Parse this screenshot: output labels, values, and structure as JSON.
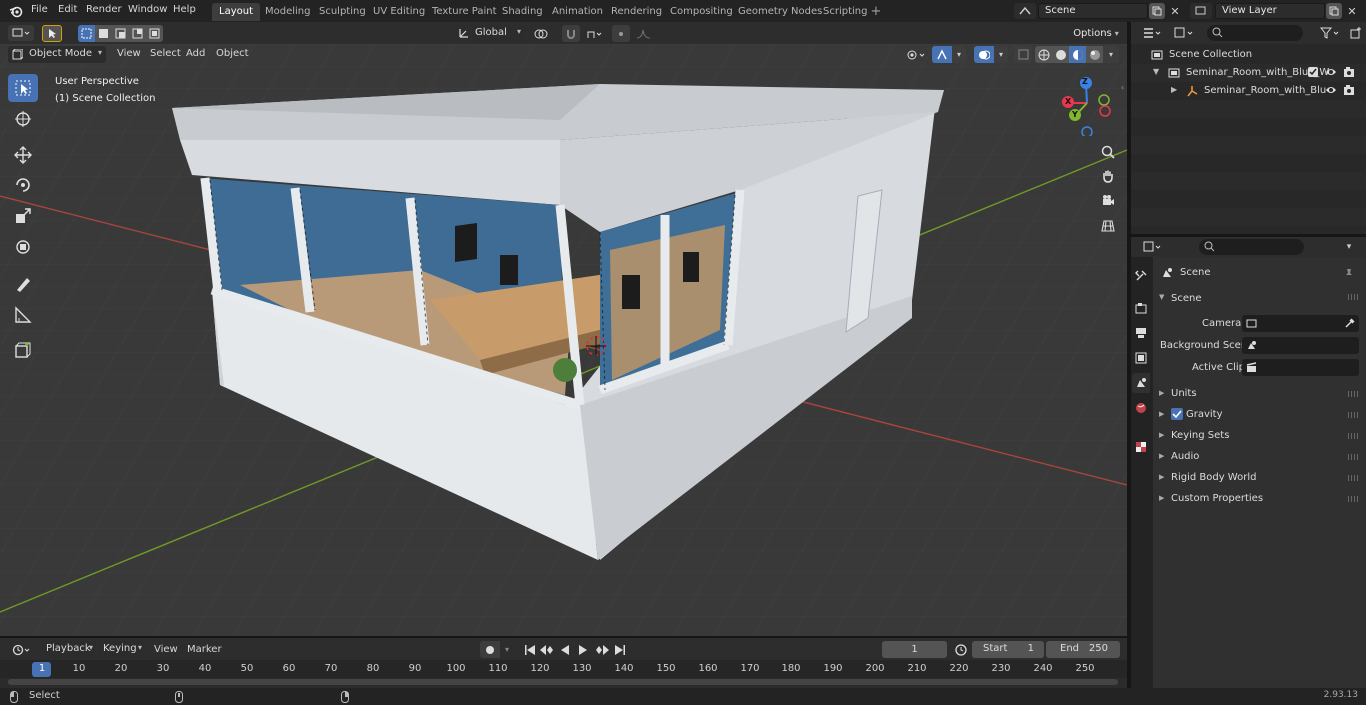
{
  "topbar": {
    "menus": [
      "File",
      "Edit",
      "Render",
      "Window",
      "Help"
    ],
    "workspaces": [
      "Layout",
      "Modeling",
      "Sculpting",
      "UV Editing",
      "Texture Paint",
      "Shading",
      "Animation",
      "Rendering",
      "Compositing",
      "Geometry Nodes",
      "Scripting"
    ],
    "active_workspace": "Layout",
    "scene_name": "Scene",
    "view_layer_name": "View Layer"
  },
  "viewport_header": {
    "mode": "Object Mode",
    "menus": [
      "View",
      "Select",
      "Add",
      "Object"
    ],
    "orientation": "Global",
    "options_label": "Options"
  },
  "viewport": {
    "perspective_label": "User Perspective",
    "collection_label": "(1) Scene Collection",
    "gizmo_axes": {
      "x": "X",
      "y": "Y",
      "z": "Z"
    }
  },
  "outliner": {
    "root": "Scene Collection",
    "items": [
      {
        "label": "Seminar_Room_with_Blue_W",
        "depth": 1
      },
      {
        "label": "Seminar_Room_with_Blu",
        "depth": 2
      }
    ]
  },
  "properties": {
    "context_title": "Scene",
    "section": "Scene",
    "fields": [
      {
        "label": "Camera",
        "value": ""
      },
      {
        "label": "Background Scene",
        "value": ""
      },
      {
        "label": "Active Clip",
        "value": ""
      }
    ],
    "panels": [
      "Units",
      "Gravity",
      "Keying Sets",
      "Audio",
      "Rigid Body World",
      "Custom Properties"
    ],
    "gravity_enabled": true
  },
  "timeline": {
    "menus": [
      "Playback",
      "Keying",
      "View",
      "Marker"
    ],
    "current_frame": "1",
    "start_label": "Start",
    "start_value": "1",
    "end_label": "End",
    "end_value": "250",
    "ticks": [
      "1",
      "10",
      "20",
      "30",
      "40",
      "50",
      "60",
      "70",
      "80",
      "90",
      "100",
      "110",
      "120",
      "130",
      "140",
      "150",
      "160",
      "170",
      "180",
      "190",
      "200",
      "210",
      "220",
      "230",
      "240",
      "250"
    ]
  },
  "status": {
    "left_label": "Select",
    "version": "2.93.13"
  },
  "colors": {
    "accent_blue": "#4772b3",
    "axis_red": "#a8453e",
    "axis_green": "#6f9a27",
    "gizmo_x": "#e8384f",
    "gizmo_y": "#7fb82d",
    "gizmo_z": "#3a83e6"
  }
}
